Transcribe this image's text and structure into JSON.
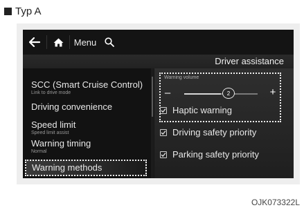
{
  "caption": {
    "text": "Typ A"
  },
  "topbar": {
    "menu_label": "Menu"
  },
  "title": "Driver assistance",
  "left_list": [
    {
      "label": "SCC (Smart Cruise Control)",
      "sub": "Link to drive mode"
    },
    {
      "label": "Driving convenience"
    },
    {
      "label": "Speed limit",
      "sub": "Speed limit assist"
    },
    {
      "label": "Warning timing",
      "sub": "Normal"
    },
    {
      "label": "Warning methods",
      "selected": true
    }
  ],
  "warning_volume": {
    "label": "Warning volume",
    "minus": "–",
    "plus": "+",
    "value": "2",
    "level_fraction": 0.5
  },
  "options": [
    {
      "label": "Haptic warning",
      "checked": true
    },
    {
      "label": "Driving safety priority",
      "checked": true
    },
    {
      "label": "Parking safety priority",
      "checked": true
    }
  ],
  "image_code": "OJK073322L",
  "colors": {
    "screen_bg": "#161616",
    "highlight_border": "#f2f2f2"
  },
  "icons": [
    "back-arrow-icon",
    "home-icon",
    "search-icon",
    "checkbox-icon"
  ]
}
